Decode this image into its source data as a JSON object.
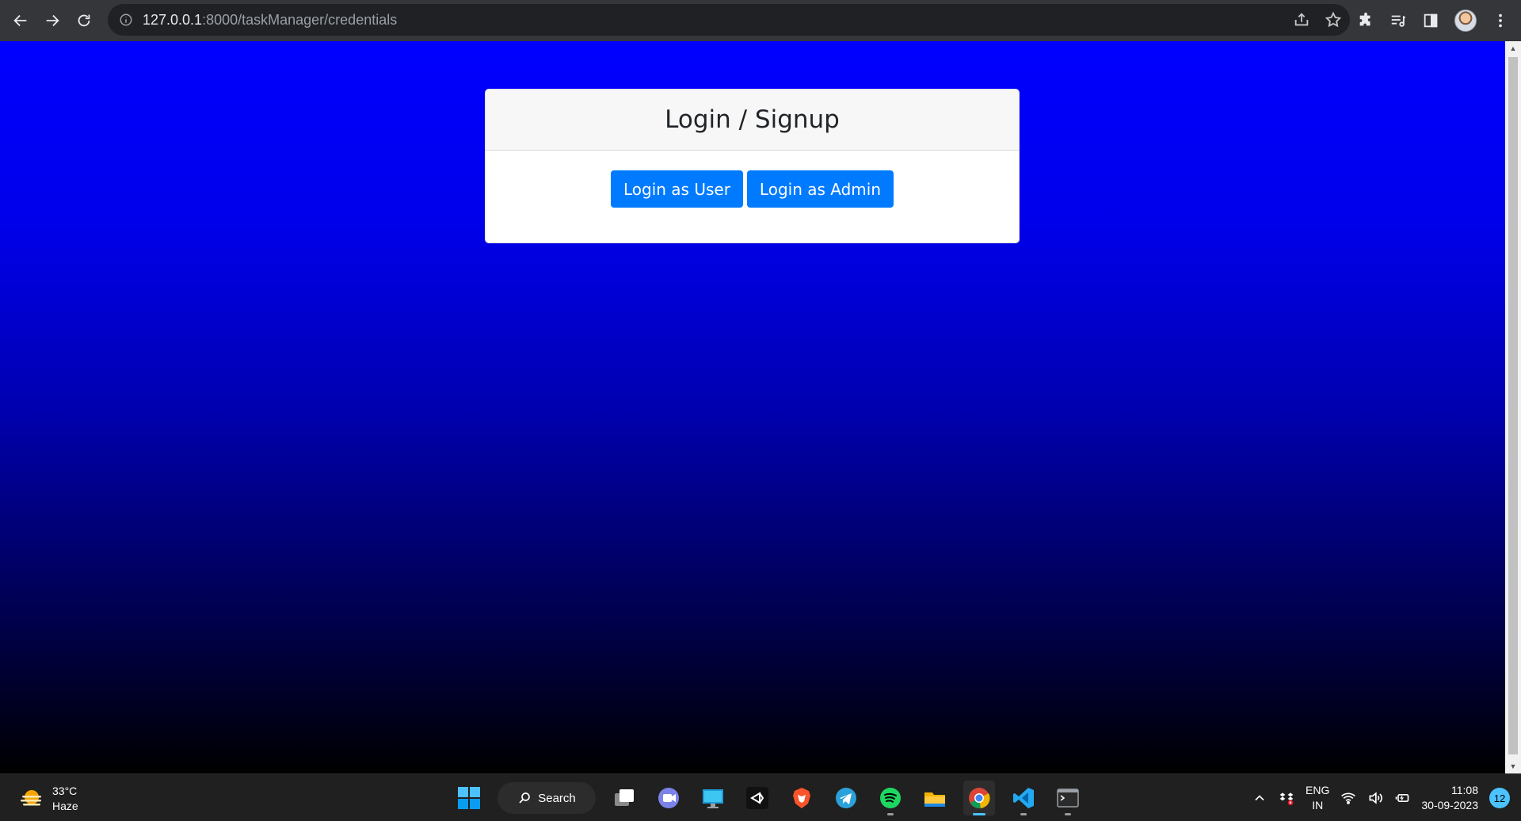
{
  "browser": {
    "url_host": "127.0.0.1",
    "url_path": ":8000/taskManager/credentials"
  },
  "card": {
    "title": "Login / Signup",
    "buttons": [
      {
        "label": "Login as User"
      },
      {
        "label": "Login as Admin"
      }
    ]
  },
  "colors": {
    "primary_button": "#007bff",
    "page_gradient_top": "#0000ff",
    "page_gradient_bottom": "#000000"
  },
  "taskbar": {
    "weather": {
      "temp": "33°C",
      "condition": "Haze"
    },
    "search_label": "Search",
    "apps": [
      "start-icon",
      "search-icon",
      "task-view-icon",
      "chat-icon",
      "desktop-app-icon",
      "unity-icon",
      "brave-icon",
      "telegram-icon",
      "spotify-icon",
      "file-explorer-icon",
      "chrome-icon",
      "vscode-icon",
      "terminal-icon"
    ],
    "tray": {
      "lang_primary": "ENG",
      "lang_secondary": "IN",
      "time": "11:08",
      "date": "30-09-2023",
      "notifications": "12"
    }
  }
}
